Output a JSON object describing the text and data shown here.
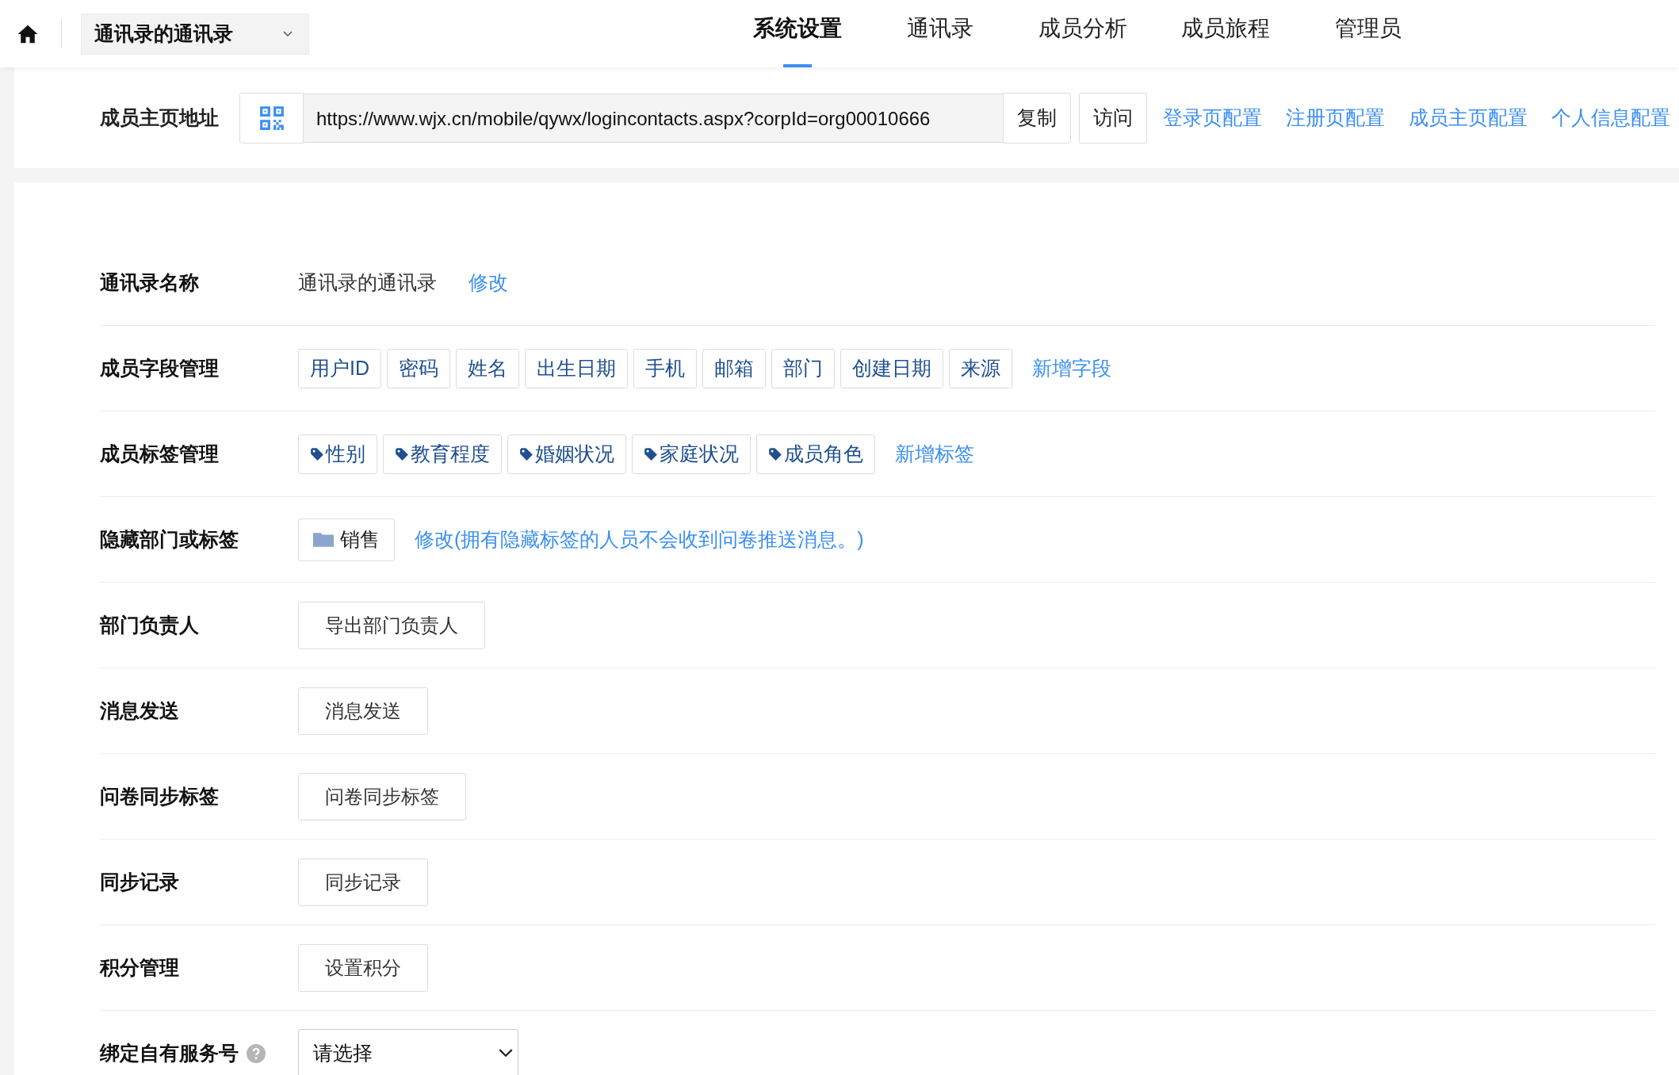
{
  "header": {
    "dropdown": {
      "value": "通讯录的通讯录"
    },
    "nav": [
      {
        "label": "系统设置",
        "selected": true
      },
      {
        "label": "通讯录",
        "selected": false
      },
      {
        "label": "成员分析",
        "selected": false
      },
      {
        "label": "成员旅程",
        "selected": false
      },
      {
        "label": "管理员",
        "selected": false
      }
    ]
  },
  "url_bar": {
    "label": "成员主页地址",
    "url": "https://www.wjx.cn/mobile/qywx/logincontacts.aspx?corpId=org00010666",
    "buttons": [
      "复制",
      "访问"
    ],
    "links": [
      "登录页配置",
      "注册页配置",
      "成员主页配置",
      "个人信息配置"
    ]
  },
  "settings": [
    {
      "kind": "text",
      "label": "通讯录名称",
      "text": "通讯录的通讯录",
      "link": "修改"
    },
    {
      "kind": "fields",
      "label": "成员字段管理",
      "items": [
        "用户ID",
        "密码",
        "姓名",
        "出生日期",
        "手机",
        "邮箱",
        "部门",
        "创建日期",
        "来源"
      ],
      "link": "新增字段"
    },
    {
      "kind": "tags",
      "label": "成员标签管理",
      "items": [
        "性别",
        "教育程度",
        "婚姻状况",
        "家庭状况",
        "成员角色"
      ],
      "link": "新增标签"
    },
    {
      "kind": "folders",
      "label": "隐藏部门或标签",
      "items": [
        "销售"
      ],
      "link": "修改(拥有隐藏标签的人员不会收到问卷推送消息。)"
    },
    {
      "kind": "button",
      "label": "部门负责人",
      "button": "导出部门负责人"
    },
    {
      "kind": "button",
      "label": "消息发送",
      "button": "消息发送"
    },
    {
      "kind": "button",
      "label": "问卷同步标签",
      "button": "问卷同步标签"
    },
    {
      "kind": "button",
      "label": "同步记录",
      "button": "同步记录"
    },
    {
      "kind": "button",
      "label": "积分管理",
      "button": "设置积分"
    },
    {
      "kind": "select",
      "label": "绑定自有服务号",
      "help": true,
      "placeholder": "请选择"
    }
  ]
}
